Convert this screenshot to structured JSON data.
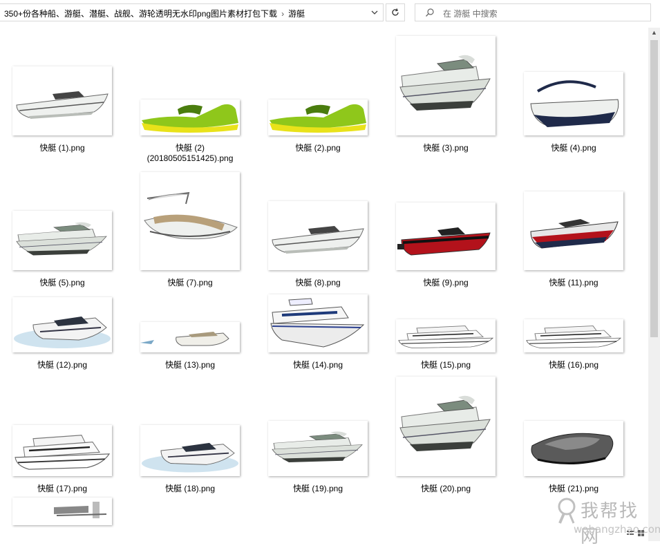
{
  "toolbar": {
    "breadcrumb_parent": "350+份各种船、游艇、潜艇、战舰、游轮透明无水印png图片素材打包下载",
    "breadcrumb_separator": "›",
    "breadcrumb_current": "游艇",
    "dropdown_icon": "chevron-down-icon",
    "refresh_icon": "refresh-icon",
    "search_placeholder": "在 游艇 中搜索",
    "search_icon": "search-icon"
  },
  "files": [
    {
      "name": "快艇 (1).png",
      "kind": "cruiser"
    },
    {
      "name": "快艇 (2)(20180505151425).png",
      "kind": "jetski"
    },
    {
      "name": "快艇 (2).png",
      "kind": "jetski"
    },
    {
      "name": "快艇 (3).png",
      "kind": "flybridge"
    },
    {
      "name": "快艇 (4).png",
      "kind": "bowrider"
    },
    {
      "name": "快艇 (5).png",
      "kind": "flybridge"
    },
    {
      "name": "快艇 (7).png",
      "kind": "deckboat"
    },
    {
      "name": "快艇 (8).png",
      "kind": "cruiser"
    },
    {
      "name": "快艇 (9).png",
      "kind": "redboat"
    },
    {
      "name": "快艇 (11).png",
      "kind": "racer"
    },
    {
      "name": "快艇 (12).png",
      "kind": "yacht"
    },
    {
      "name": "快艇 (13).png",
      "kind": "yachtsmall"
    },
    {
      "name": "快艇 (14).png",
      "kind": "trawler"
    },
    {
      "name": "快艇 (15).png",
      "kind": "superyacht"
    },
    {
      "name": "快艇 (16).png",
      "kind": "superyacht"
    },
    {
      "name": "快艇 (17).png",
      "kind": "superyacht"
    },
    {
      "name": "快艇 (18).png",
      "kind": "yacht"
    },
    {
      "name": "快艇 (19).png",
      "kind": "flybridge"
    },
    {
      "name": "快艇 (20).png",
      "kind": "flybridge"
    },
    {
      "name": "快艇 (21).png",
      "kind": "darkboat"
    },
    {
      "name": "",
      "kind": "partial"
    }
  ],
  "watermark": {
    "title": "我帮找网",
    "url": "wobangzhao.com"
  },
  "colors": {
    "hull_white": "#eef0ee",
    "hull_shadow": "#b9bdb8",
    "jetski_green": "#8fc71b",
    "jetski_yellow": "#e9e21a",
    "navy": "#1f2a4a",
    "red": "#b3121b",
    "water_blue": "#cfe3ef"
  }
}
